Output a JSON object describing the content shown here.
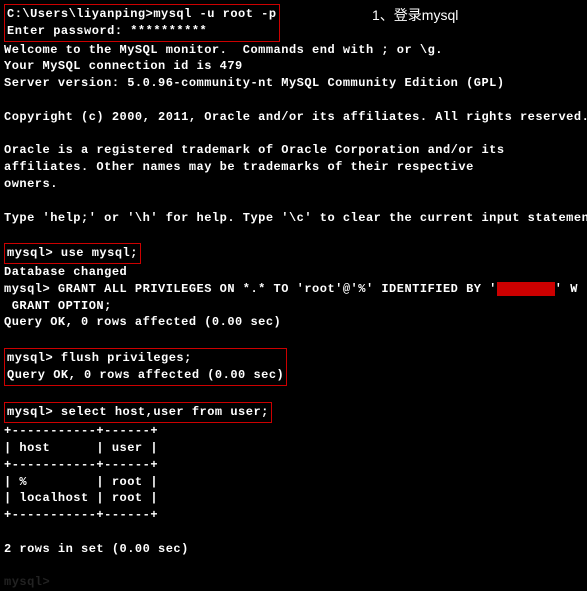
{
  "annotation": "1、登录mysql",
  "shell": {
    "prompt_cmd": "C:\\Users\\liyanping>mysql -u root -p",
    "enter_password": "Enter password: **********"
  },
  "banner": {
    "welcome": "Welcome to the MySQL monitor.  Commands end with ; or \\g.",
    "conn_id": "Your MySQL connection id is 479",
    "server_version": "Server version: 5.0.96-community-nt MySQL Community Edition (GPL)",
    "copyright": "Copyright (c) 2000, 2011, Oracle and/or its affiliates. All rights reserved.",
    "trademark1": "Oracle is a registered trademark of Oracle Corporation and/or its",
    "trademark2": "affiliates. Other names may be trademarks of their respective",
    "trademark3": "owners.",
    "help": "Type 'help;' or '\\h' for help. Type '\\c' to clear the current input statement"
  },
  "stmts": {
    "use": "mysql> use mysql;",
    "db_changed": "Database changed",
    "grant_pre": "mysql> GRANT ALL PRIVILEGES ON *.* TO 'root'@'%' IDENTIFIED BY '",
    "grant_post": "' W",
    "grant_cont": " GRANT OPTION;",
    "grant_ok": "Query OK, 0 rows affected (0.00 sec)",
    "flush": "mysql> flush privileges;",
    "flush_ok": "Query OK, 0 rows affected (0.00 sec)",
    "select": "mysql> select host,user from user;"
  },
  "table": {
    "sep": "+-----------+------+",
    "header": "| host      | user |",
    "row1": "| %         | root |",
    "row2": "| localhost | root |",
    "footer": "2 rows in set (0.00 sec)"
  },
  "last_prompt": "mysql>"
}
